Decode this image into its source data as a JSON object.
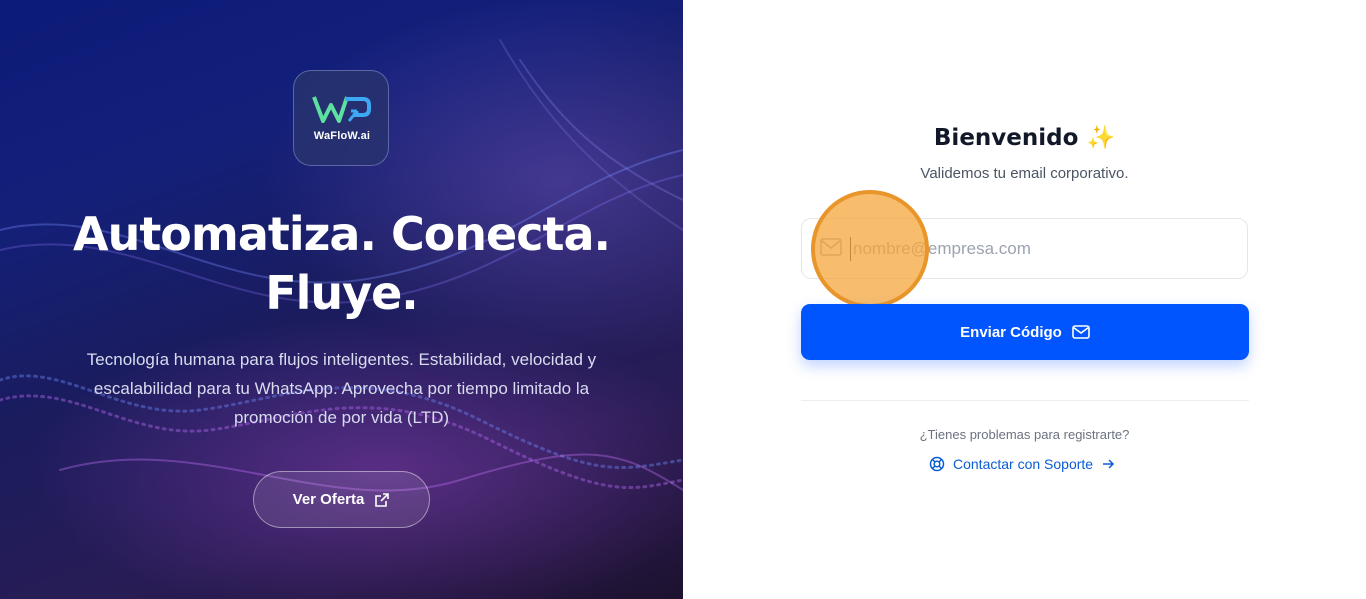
{
  "hero": {
    "logo_text": "WaFloW.ai",
    "headline_line1": "Automatiza. Conecta.",
    "headline_line2": "Fluye.",
    "description": "Tecnología humana para flujos inteligentes. Estabilidad, velocidad y escalabilidad para tu WhatsApp. Aprovecha por tiempo limitado la promoción de por vida (LTD)",
    "offer_button": "Ver Oferta",
    "offer_icon": "external-link-icon"
  },
  "login": {
    "title": "Bienvenido",
    "title_emoji": "✨",
    "subtitle": "Validemos tu email corporativo.",
    "email_placeholder": "nombre@empresa.com",
    "email_value": "",
    "email_icon": "mail-icon",
    "send_button": "Enviar Código",
    "problems_text": "¿Tienes problemas para registrarte?",
    "support_link": "Contactar con Soporte",
    "support_icon": "lifebuoy-icon",
    "support_arrow": "arrow-right-icon"
  },
  "colors": {
    "primary": "#0055ff",
    "link": "#0b5cd5",
    "highlight": "#f5a63c"
  }
}
